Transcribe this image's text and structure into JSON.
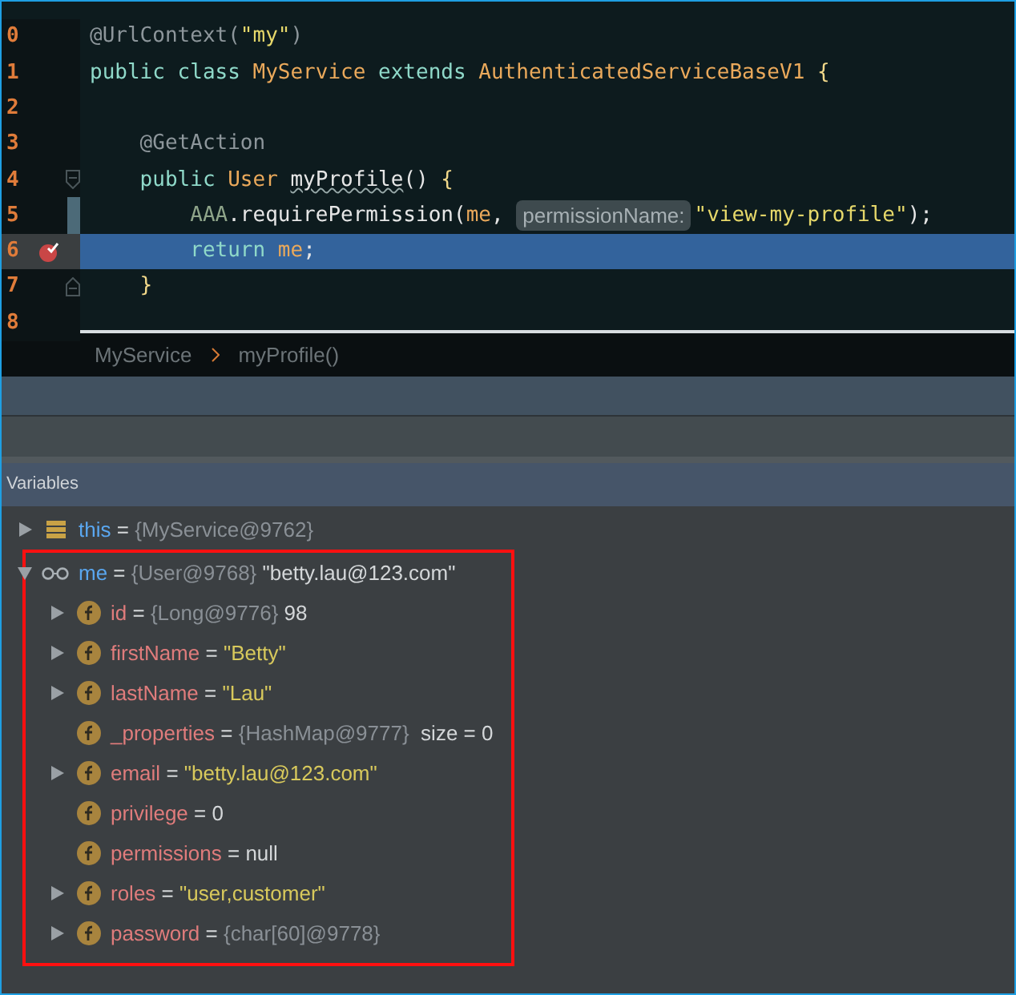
{
  "editor": {
    "lines": [
      {
        "number": "0",
        "kind": "plain",
        "highlighted": false,
        "breakpoint": false,
        "modified": false,
        "tokens": [
          {
            "text": "@UrlContext(",
            "kind": "annotation"
          },
          {
            "text": "\"my\"",
            "kind": "string"
          },
          {
            "text": ")",
            "kind": "annotation"
          }
        ]
      },
      {
        "number": "1",
        "kind": "plain",
        "highlighted": false,
        "breakpoint": false,
        "modified": false,
        "tokens": [
          {
            "text": "public class ",
            "kind": "keyword"
          },
          {
            "text": "MyService ",
            "kind": "type"
          },
          {
            "text": "extends ",
            "kind": "keyword"
          },
          {
            "text": "AuthenticatedServiceBaseV1 ",
            "kind": "type"
          },
          {
            "text": "{",
            "kind": "brace"
          }
        ]
      },
      {
        "number": "2",
        "kind": "plain",
        "highlighted": false,
        "breakpoint": false,
        "modified": false
      },
      {
        "number": "3",
        "kind": "plain",
        "highlighted": false,
        "breakpoint": false,
        "modified": false,
        "tokens": [
          {
            "text": "    @GetAction",
            "kind": "annotation"
          }
        ]
      },
      {
        "number": "4",
        "kind": "fold_start",
        "highlighted": false,
        "breakpoint": false,
        "modified": false,
        "tokens": [
          {
            "text": "    public ",
            "kind": "keyword"
          },
          {
            "text": "User ",
            "kind": "type"
          },
          {
            "text": "myProfile",
            "kind": "method"
          },
          {
            "text": "() ",
            "kind": "plain"
          },
          {
            "text": "{",
            "kind": "brace"
          }
        ]
      },
      {
        "number": "5",
        "kind": "plain",
        "highlighted": false,
        "breakpoint": false,
        "modified": true,
        "tokens": [
          {
            "text": "        AAA",
            "kind": "class"
          },
          {
            "text": ".requirePermission(",
            "kind": "plain"
          },
          {
            "text": "me",
            "kind": "variable"
          },
          {
            "text": ", ",
            "kind": "plain"
          },
          {
            "text": "permissionName:",
            "kind": "hint"
          },
          {
            "text": "\"view-my-profile\"",
            "kind": "string"
          },
          {
            "text": ");",
            "kind": "plain"
          }
        ]
      },
      {
        "number": "6",
        "kind": "plain",
        "highlighted": true,
        "breakpoint": true,
        "modified": false,
        "tokens": [
          {
            "text": "        return ",
            "kind": "keyword"
          },
          {
            "text": "me",
            "kind": "variable"
          },
          {
            "text": ";",
            "kind": "plain"
          }
        ]
      },
      {
        "number": "7",
        "kind": "fold_end",
        "highlighted": false,
        "breakpoint": false,
        "modified": false,
        "tokens": [
          {
            "text": "    }",
            "kind": "brace"
          }
        ]
      },
      {
        "number": "8",
        "kind": "plain",
        "highlighted": false,
        "breakpoint": false,
        "modified": false
      }
    ]
  },
  "breadcrumb": [
    "MyService",
    "myProfile()"
  ],
  "variables_panel": {
    "title": "Variables",
    "items": [
      {
        "kind": "stack_local",
        "name": "this",
        "expandable": true,
        "expanded": false,
        "highlight": false,
        "value": [
          {
            "text": "=",
            "kind": "op"
          },
          {
            "text": "{MyService@9762}",
            "kind": "ref"
          }
        ]
      },
      {
        "kind": "watch",
        "name": "me",
        "expandable": true,
        "expanded": true,
        "highlight": true,
        "value": [
          {
            "text": "=",
            "kind": "op"
          },
          {
            "text": "{User@9768}",
            "kind": "ref"
          },
          {
            "text": "\"betty.lau@123.com\"",
            "kind": "plain"
          }
        ],
        "children": [
          {
            "kind": "field",
            "name": "id",
            "expandable": true,
            "highlight": false,
            "value": [
              {
                "text": "=",
                "kind": "op"
              },
              {
                "text": "{Long@9776}",
                "kind": "ref"
              },
              {
                "text": "98",
                "kind": "plain"
              }
            ]
          },
          {
            "kind": "field",
            "name": "firstName",
            "expandable": true,
            "highlight": false,
            "value": [
              {
                "text": "=",
                "kind": "op"
              },
              {
                "text": "\"Betty\"",
                "kind": "string"
              }
            ]
          },
          {
            "kind": "field",
            "name": "lastName",
            "expandable": true,
            "highlight": false,
            "value": [
              {
                "text": "=",
                "kind": "op"
              },
              {
                "text": "\"Lau\"",
                "kind": "string"
              }
            ]
          },
          {
            "kind": "field",
            "name": "_properties",
            "expandable": false,
            "highlight": false,
            "value": [
              {
                "text": "=",
                "kind": "op"
              },
              {
                "text": "{HashMap@9777}",
                "kind": "ref"
              },
              {
                "text": " size = 0",
                "kind": "plain"
              }
            ]
          },
          {
            "kind": "field",
            "name": "email",
            "expandable": true,
            "highlight": false,
            "value": [
              {
                "text": "=",
                "kind": "op"
              },
              {
                "text": "\"betty.lau@123.com\"",
                "kind": "string"
              }
            ]
          },
          {
            "kind": "field",
            "name": "privilege",
            "expandable": false,
            "highlight": false,
            "value": [
              {
                "text": "=",
                "kind": "op"
              },
              {
                "text": "0",
                "kind": "plain"
              }
            ]
          },
          {
            "kind": "field",
            "name": "permissions",
            "expandable": false,
            "highlight": false,
            "value": [
              {
                "text": "=",
                "kind": "op"
              },
              {
                "text": "null",
                "kind": "plain"
              }
            ]
          },
          {
            "kind": "field",
            "name": "roles",
            "expandable": true,
            "highlight": false,
            "value": [
              {
                "text": "=",
                "kind": "op"
              },
              {
                "text": "\"user,customer\"",
                "kind": "string"
              }
            ]
          },
          {
            "kind": "field",
            "name": "password",
            "expandable": true,
            "highlight": false,
            "value": [
              {
                "text": "=",
                "kind": "op"
              },
              {
                "text": "{char[60]@9778}",
                "kind": "ref"
              }
            ]
          }
        ]
      }
    ]
  }
}
